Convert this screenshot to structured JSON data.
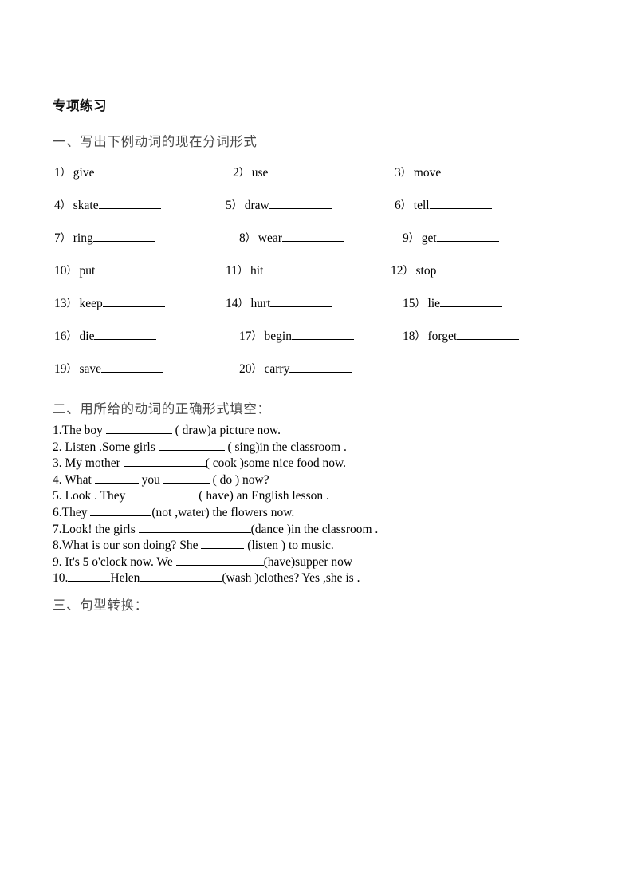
{
  "document": {
    "title": "专项练习"
  },
  "sections": [
    {
      "heading": "一、写出下例动词的现在分词形式",
      "items": [
        {
          "num": "1",
          "word": "give"
        },
        {
          "num": "2",
          "word": "use"
        },
        {
          "num": "3",
          "word": "move"
        },
        {
          "num": "4",
          "word": "skate"
        },
        {
          "num": "5",
          "word": "draw"
        },
        {
          "num": "6",
          "word": "tell"
        },
        {
          "num": "7",
          "word": "ring"
        },
        {
          "num": "8",
          "word": "wear"
        },
        {
          "num": "9",
          "word": "get"
        },
        {
          "num": "10",
          "word": "put"
        },
        {
          "num": "11",
          "word": "hit"
        },
        {
          "num": "12",
          "word": "stop"
        },
        {
          "num": "13",
          "word": "keep"
        },
        {
          "num": "14",
          "word": "hurt"
        },
        {
          "num": "15",
          "word": "lie"
        },
        {
          "num": "16",
          "word": "die"
        },
        {
          "num": "17",
          "word": "begin"
        },
        {
          "num": "18",
          "word": "forget"
        },
        {
          "num": "19",
          "word": "save"
        },
        {
          "num": "20",
          "word": "carry"
        }
      ],
      "paren_mark": "）"
    },
    {
      "heading": "二、用所给的动词的正确形式填空：",
      "sentences": [
        {
          "num": "1.",
          "pre": "The boy ",
          "post": " ( draw)a picture now."
        },
        {
          "num": "2. ",
          "pre": "Listen .Some girls ",
          "post": " ( sing)in the classroom ."
        },
        {
          "num": "3. ",
          "pre": "My mother ",
          "post": "( cook )some nice food    now."
        },
        {
          "num": "4. ",
          "pre": "What ",
          "post": " ( do ) now?"
        },
        {
          "num": "5. ",
          "pre": "Look . They ",
          "post": "( have) an English lesson ."
        },
        {
          "num": "6.",
          "pre": "They ",
          "post": "(not ,water) the flowers now."
        },
        {
          "num": "7.",
          "pre": "Look! the girls ",
          "post": "(dance )in the classroom ."
        },
        {
          "num": "8.",
          "pre": "What is our son doing? She ",
          "post": " (listen ) to music."
        },
        {
          "num": "9. ",
          "pre": "It's   5   o'clock now. We ",
          "post": "(have)supper now"
        },
        {
          "num": "10.",
          "pre": "",
          "post": "(wash )clothes? Yes ,she is ."
        }
      ],
      "sentence_4_middle": " you ",
      "sentence_10_middle": "Helen"
    },
    {
      "heading": "三、句型转换："
    }
  ],
  "colors": {
    "text": "#000000",
    "heading_cn": "#4a4a4a",
    "rule": "#000000",
    "background": "#ffffff"
  }
}
